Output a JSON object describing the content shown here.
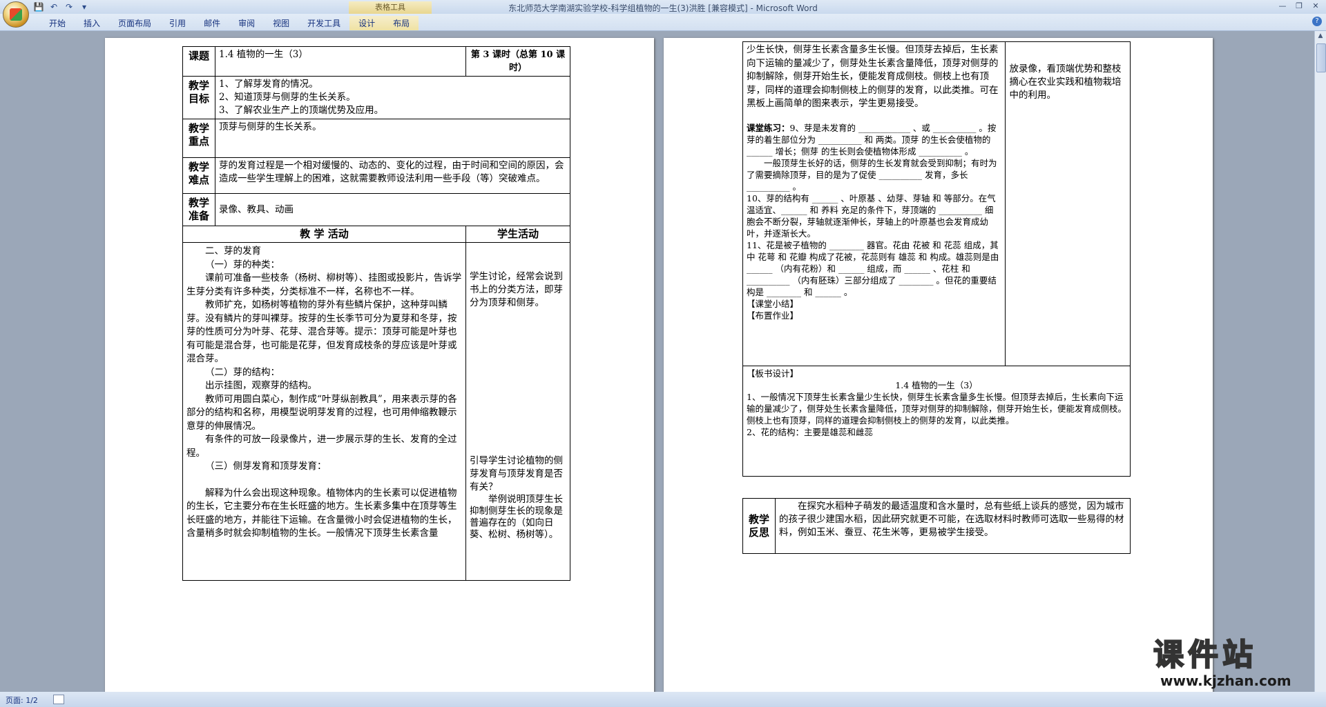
{
  "window": {
    "title": "东北师范大学南湖实验学校-科学组植物的一生(3)洪胜 [兼容模式] - Microsoft Word",
    "context_tab_group": "表格工具"
  },
  "ribbon": {
    "tabs": [
      "开始",
      "插入",
      "页面布局",
      "引用",
      "邮件",
      "审阅",
      "视图",
      "开发工具",
      "设计",
      "布局"
    ]
  },
  "status": {
    "pages": "页面: 1/2"
  },
  "left_page": {
    "topic_label": "课题",
    "topic": "1.4 植物的一生（3）",
    "lesson": "第 3 课时（总第 10 课时）",
    "goals_label": "教学目标",
    "goals": [
      "1、了解芽发育的情况。",
      "2、知道顶芽与侧芽的生长关系。",
      "3、了解农业生产上的顶端优势及应用。"
    ],
    "key_label": "教学重点",
    "key": "顶芽与侧芽的生长关系。",
    "diff_label": "教学难点",
    "diff": "芽的发育过程是一个相对缓慢的、动态的、变化的过程，由于时间和空间的原因，会造成一些学生理解上的困难，这就需要教师设法利用一些手段（等）突破难点。",
    "prep_label": "教学准备",
    "prep": "录像、教具、动画",
    "activity_header": "教 学 活动",
    "student_header": "学生活动",
    "activity": [
      "二、芽的发育",
      "（一）芽的种类：",
      "课前可准备一些枝条（杨树、柳树等）、挂图或投影片，告诉学生芽分类有许多种类，分类标准不一样，名称也不一样。",
      "教师扩充，如杨树等植物的芽外有些鳞片保护，这种芽叫鳞芽。没有鳞片的芽叫裸芽。按芽的生长季节可分为夏芽和冬芽，按芽的性质可分为叶芽、花芽、混合芽等。提示：顶芽可能是叶芽也有可能是混合芽，也可能是花芽，但发育成枝条的芽应该是叶芽或混合芽。",
      "（二）芽的结构：",
      "出示挂图，观察芽的结构。",
      "教师可用圆白菜心，制作成“叶芽纵剖教具”，用来表示芽的各部分的结构和名称，用模型说明芽发育的过程，也可用伸缩教鞭示意芽的伸展情况。",
      "有条件的可放一段录像片，进一步展示芽的生长、发育的全过程。",
      "（三）侧芽发育和顶芽发育：",
      "解释为什么会出现这种现象。植物体内的生长素可以促进植物的生长，它主要分布在生长旺盛的地方。生长素多集中在顶芽等生长旺盛的地方，并能往下运输。在含量微小时会促进植物的生长，含量稍多时就会抑制植物的生长。一般情况下顶芽生长素含量"
    ],
    "student": [
      "学生讨论，经常会说到书上的分类方法，即芽分为顶芽和侧芽。",
      "引导学生讨论植物的侧芽发育与顶芽发育是否有关？",
      "举例说明顶芽生长抑制侧芽生长的现象是普遍存在的（如向日葵、松树、杨树等）。"
    ]
  },
  "right_page": {
    "cont": "少生长快，侧芽生长素含量多生长慢。但顶芽去掉后，生长素向下运输的量减少了，侧芽处生长素含量降低，顶芽对侧芽的抑制解除，侧芽开始生长，便能发育成侧枝。侧枝上也有顶芽，同样的道理会抑制侧枝上的侧芽的发育，以此类推。可在黑板上画简单的图来表示，学生更易接受。",
    "side": "放录像，看顶端优势和整枝摘心在农业实践和植物栽培中的利用。",
    "practice_title": "课堂练习：",
    "practice": [
      "9、芽是未发育的 ____________ 、或 __________ 。按芽的着生部位分为 __________ 和 两类。顶芽 的生长会使植物的 ______ 增长；侧芽 的生长则会使植物体形成 __________ 。",
      "一般顶芽生长好的话，侧芽的生长发育就会受到抑制；有时为了需要摘除顶芽，目的是为了促使 __________ 发育，多长 __________ 。",
      "10、芽的结构有 ______ 、叶原基 、幼芽、芽轴 和 等部分。在气温适宜、______ 和 养料 充足的条件下，芽顶端的 __________ 细胞会不断分裂，芽轴就逐渐伸长，芽轴上的叶原基也会发育成幼叶，并逐渐长大。",
      "11、花是被子植物的 ________ 器官。花由 花被 和 花蕊 组成，其中 花萼 和 花瓣 构成了花被，花蕊则有 雄蕊 和 构成。雄蕊则是由 ______ （内有花粉）和 ______ 组成，而 ______ 、花柱 和 __________ （内有胚珠）三部分组成了 ________ 。但花的重要结构是 ________ 和 ______ 。"
    ],
    "summary": "【课堂小结】",
    "homework": "【布置作业】",
    "board_label": "【板书设计】",
    "board_title": "1.4 植物的一生（3）",
    "board_lines": [
      "1、一般情况下顶芽生长素含量少生长快，侧芽生长素含量多生长慢。但顶芽去掉后，生长素向下运输的量减少了，侧芽处生长素含量降低，顶芽对侧芽的抑制解除，侧芽开始生长，便能发育成侧枝。侧枝上也有顶芽，同样的道理会抑制侧枝上的侧芽的发育，以此类推。",
      "2、花的结构：主要是雄蕊和雌蕊"
    ],
    "reflect_label": "教学反思",
    "reflect": "在探究水稻种子萌发的最适温度和含水量时，总有些纸上谈兵的感觉，因为城市的孩子很少建国水稻，因此研究就更不可能，在选取材料时教师可选取一些易得的材料，例如玉米、蚕豆、花生米等，更易被学生接受。"
  },
  "watermark": {
    "big": "课件站",
    "small": "www.kjzhan.com"
  }
}
